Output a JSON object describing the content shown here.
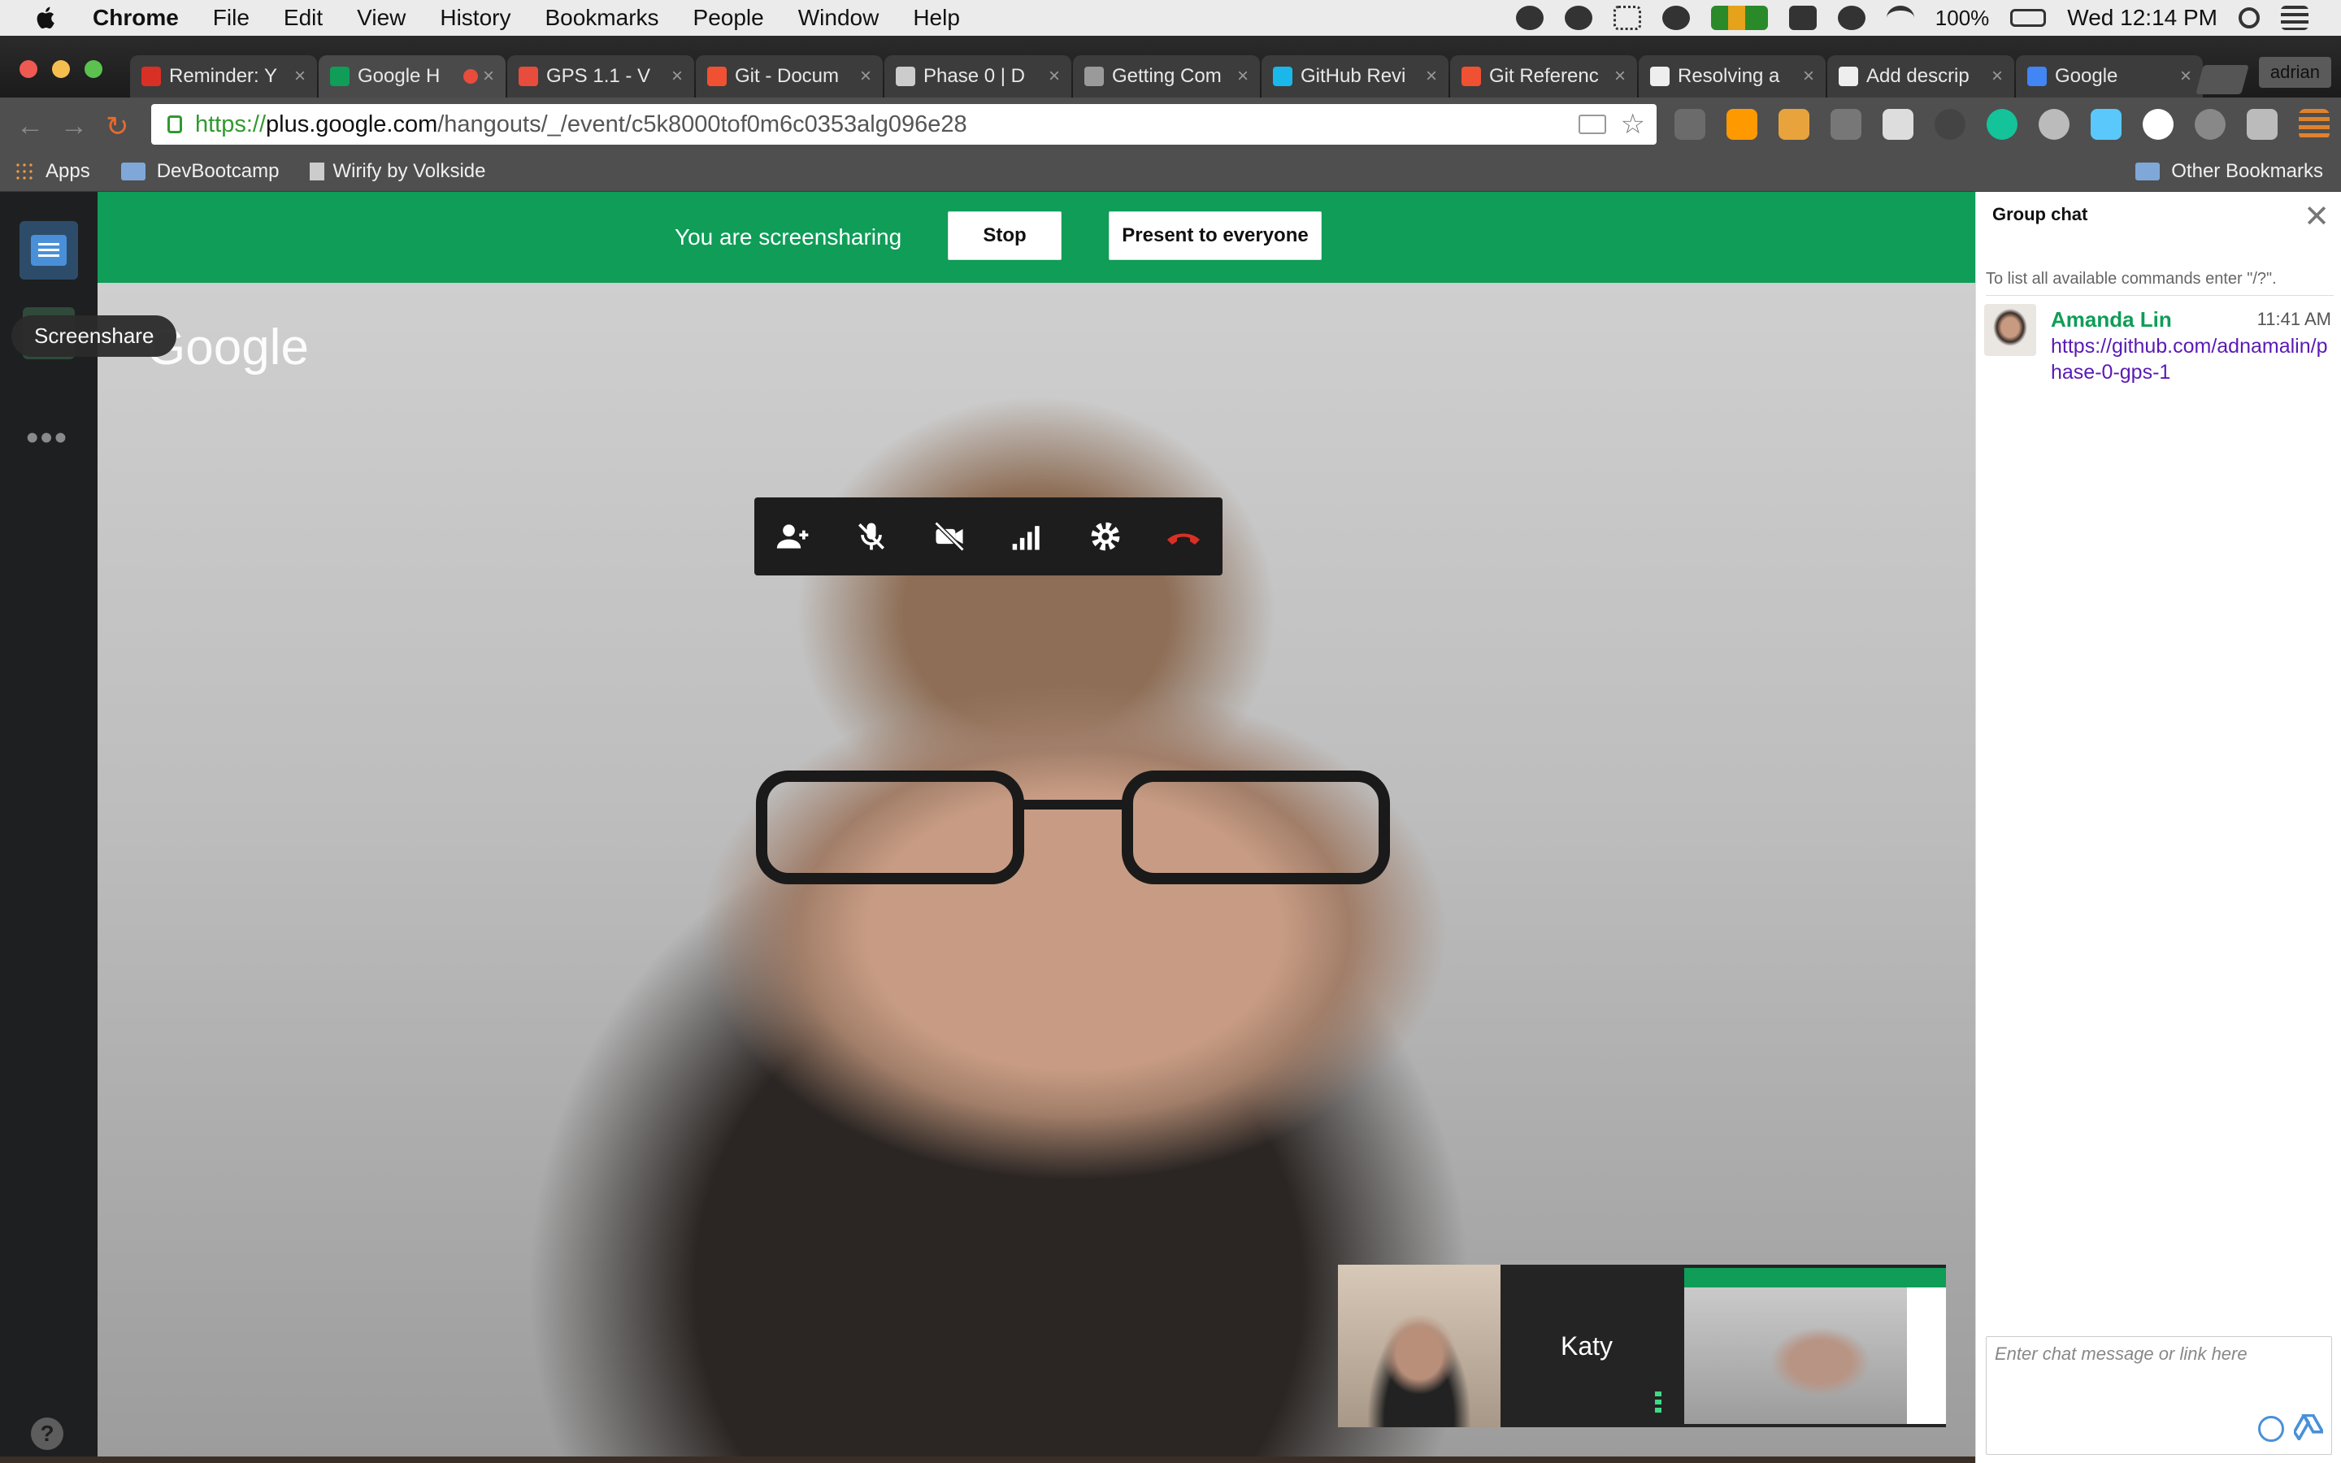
{
  "menubar": {
    "app_name": "Chrome",
    "menus": [
      "File",
      "Edit",
      "View",
      "History",
      "Bookmarks",
      "People",
      "Window",
      "Help"
    ],
    "battery": "100%",
    "clock": "Wed 12:14 PM"
  },
  "tabs": [
    {
      "title": "Reminder: Y",
      "favicon_color": "#d93025"
    },
    {
      "title": "Google H",
      "favicon_color": "#0f9d58",
      "active": true
    },
    {
      "title": "GPS 1.1 - V",
      "favicon_color": "#e74c3c"
    },
    {
      "title": "Git - Docum",
      "favicon_color": "#f05133"
    },
    {
      "title": "Phase 0 | D",
      "favicon_color": "#cccccc"
    },
    {
      "title": "Getting Com",
      "favicon_color": "#9a9a9a"
    },
    {
      "title": "GitHub Revi",
      "favicon_color": "#1ab7ea"
    },
    {
      "title": "Git Referenc",
      "favicon_color": "#f05133"
    },
    {
      "title": "Resolving a",
      "favicon_color": "#eeeeee"
    },
    {
      "title": "Add descrip",
      "favicon_color": "#eeeeee"
    },
    {
      "title": "Google",
      "favicon_color": "#4285f4"
    }
  ],
  "profile_name": "adrian",
  "address": {
    "scheme": "https://",
    "host": "plus.google.com",
    "path": "/hangouts/_/event/c5k8000tof0m6c0353alg096e28"
  },
  "bookmarks": {
    "apps": "Apps",
    "items": [
      "DevBootcamp",
      "Wirify by Volkside"
    ],
    "other": "Other Bookmarks"
  },
  "hangout": {
    "banner_text": "You are screensharing",
    "stop_label": "Stop",
    "present_label": "Present to everyone",
    "watermark": "Google",
    "tooltip": "Screenshare",
    "help_glyph": "?",
    "participants": [
      {
        "name": "Amanda Lin"
      },
      {
        "name": "Katy"
      }
    ],
    "controls": [
      "invite-icon",
      "mute-mic-icon",
      "camera-off-icon",
      "bandwidth-icon",
      "settings-icon",
      "hang-up-icon"
    ]
  },
  "chat": {
    "title": "Group chat",
    "hint": "To list all available commands enter \"/?\".",
    "messages": [
      {
        "sender": "Amanda Lin",
        "time": "11:41 AM",
        "text": "https://github.com/adnamalin/phase-0-gps-1"
      }
    ],
    "input_placeholder": "Enter chat message or link here"
  },
  "colors": {
    "banner_green": "#0f9d58",
    "sender_green": "#0f9d58",
    "link_purple": "#5a1ab5",
    "hangup_red": "#d93025"
  }
}
